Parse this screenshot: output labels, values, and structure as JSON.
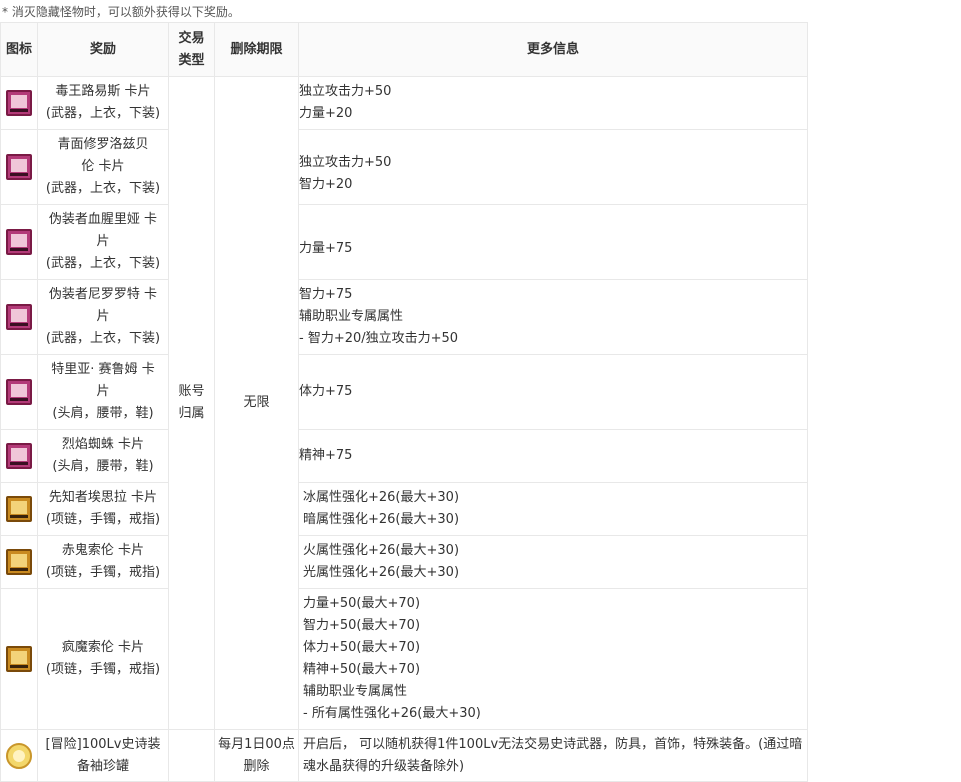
{
  "note": "* 消灭隐藏怪物时，可以额外获得以下奖励。",
  "headers": {
    "icon": "图标",
    "reward": "奖励",
    "trade": [
      "交易",
      "类型"
    ],
    "expiry": "删除期限",
    "info": "更多信息"
  },
  "merged": {
    "trade_main": [
      "账号",
      "归属"
    ],
    "expiry_main": "无限",
    "expiry_last": [
      "每月1日00点",
      "删除"
    ]
  },
  "rows": [
    {
      "icon": "magenta-card-icon",
      "name": [
        "毒王路易斯  卡片"
      ],
      "slots": "(武器，上衣，下装)",
      "info": [
        "独立攻击力+50",
        "力量+20"
      ]
    },
    {
      "icon": "magenta-card-icon",
      "name": [
        "青面修罗洛兹贝",
        "伦  卡片"
      ],
      "slots": "(武器，上衣，下装)",
      "info": [
        "独立攻击力+50",
        "智力+20"
      ]
    },
    {
      "icon": "magenta-card-icon",
      "name": [
        "伪装者血腥里娅  卡",
        "片"
      ],
      "slots": "(武器，上衣，下装)",
      "info": [
        "力量+75"
      ]
    },
    {
      "icon": "magenta-card-icon",
      "name": [
        "伪装者尼罗罗特  卡",
        "片"
      ],
      "slots": "(武器，上衣，下装)",
      "info": [
        "智力+75",
        "辅助职业专属属性",
        "- 智力+20/独立攻击力+50"
      ]
    },
    {
      "icon": "magenta-card-icon",
      "name": [
        "特里亚· 赛鲁姆  卡",
        "片"
      ],
      "slots": "(头肩，腰带，鞋)",
      "info": [
        "体力+75"
      ]
    },
    {
      "icon": "magenta-card-icon",
      "name": [
        "烈焰蜘蛛  卡片"
      ],
      "slots": "(头肩，腰带，鞋)",
      "info": [
        "精神+75"
      ]
    },
    {
      "icon": "gold-card-icon",
      "name": [
        "先知者埃思拉  卡片"
      ],
      "slots": "(项链，手镯，戒指)",
      "info": [
        "冰属性强化+26(最大+30)",
        "暗属性强化+26(最大+30)"
      ]
    },
    {
      "icon": "gold-card-icon",
      "name": [
        "赤鬼索伦 卡片"
      ],
      "slots": "(项链，手镯，戒指)",
      "info": [
        "火属性强化+26(最大+30)",
        "光属性强化+26(最大+30)"
      ]
    },
    {
      "icon": "gold-card-icon",
      "name": [
        "疯魔索伦 卡片"
      ],
      "slots": "(项链，手镯，戒指)",
      "info": [
        "力量+50(最大+70)",
        "智力+50(最大+70)",
        "体力+50(最大+70)",
        "精神+50(最大+70)",
        "辅助职业专属属性",
        "- 所有属性强化+26(最大+30)"
      ]
    },
    {
      "icon": "gift-box-icon",
      "name": [
        "[冒险]100Lv史诗装",
        "备袖珍罐"
      ],
      "slots": "",
      "info": [
        "开启后，  可以随机获得1件100Lv无法交易史诗武器，防具，首饰，特殊装备。(通过暗",
        "魂水晶获得的升级装备除外)"
      ]
    }
  ]
}
